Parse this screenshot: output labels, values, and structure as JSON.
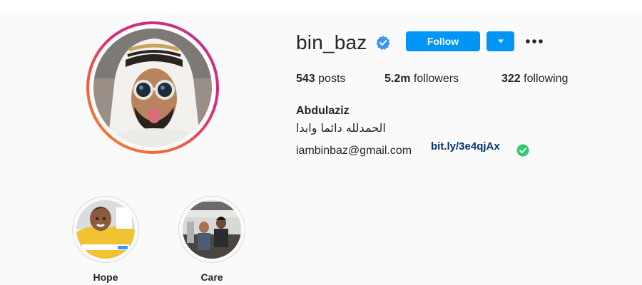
{
  "profile": {
    "username": "bin_baz",
    "verified_icon": "verified-badge-icon",
    "follow_label": "Follow",
    "dropdown_icon": "caret-down-icon",
    "more_icon": "more-options-icon",
    "full_name": "Abdulaziz",
    "bio": "الحمدلله دائما وابدا",
    "email": "iambinbaz@gmail.com",
    "link": "bit.ly/3e4qjAx",
    "link_check_icon": "check-circle-icon"
  },
  "stats": {
    "posts_count": "543",
    "posts_label": "posts",
    "followers_count": "5.2m",
    "followers_label": "followers",
    "following_count": "322",
    "following_label": "following"
  },
  "highlights": [
    {
      "label": "Hope"
    },
    {
      "label": "Care"
    }
  ],
  "colors": {
    "accent": "#0095f6",
    "link": "#00376b",
    "verified": "#3897f0",
    "check": "#2ecc71",
    "text": "#262626",
    "background": "#fafafa"
  }
}
